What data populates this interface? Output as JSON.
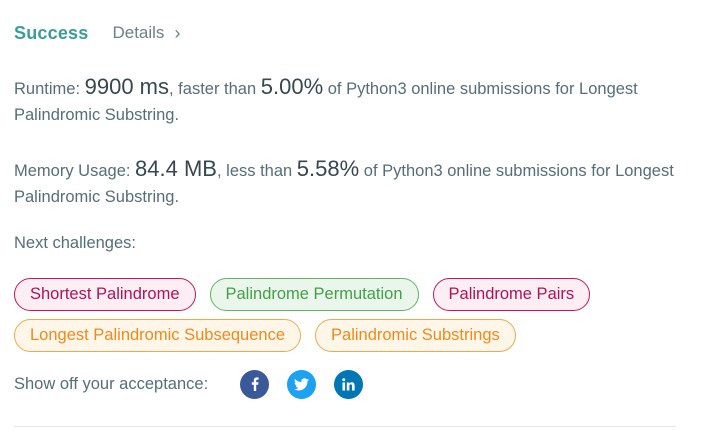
{
  "header": {
    "status": "Success",
    "details_label": "Details",
    "chevron": "›"
  },
  "runtime": {
    "label": "Runtime:",
    "value": "9900 ms",
    "comparison_text": ", faster than",
    "percent": "5.00%",
    "suffix": "of Python3 online submissions for Longest Palindromic Substring."
  },
  "memory": {
    "label": "Memory Usage:",
    "value": "84.4 MB",
    "comparison_text": ", less than",
    "percent": "5.58%",
    "suffix": "of Python3 online submissions for Longest Palindromic Substring."
  },
  "next": {
    "label": "Next challenges:",
    "challenges": [
      {
        "title": "Shortest Palindrome",
        "difficulty": "hard"
      },
      {
        "title": "Palindrome Permutation",
        "difficulty": "easy"
      },
      {
        "title": "Palindrome Pairs",
        "difficulty": "hard"
      },
      {
        "title": "Longest Palindromic Subsequence",
        "difficulty": "medium"
      },
      {
        "title": "Palindromic Substrings",
        "difficulty": "medium"
      }
    ]
  },
  "share": {
    "label": "Show off your acceptance:",
    "icons": [
      {
        "name": "facebook-icon",
        "color": "#3b5998"
      },
      {
        "name": "twitter-icon",
        "color": "#1da1f2"
      },
      {
        "name": "linkedin-icon",
        "color": "#0077b5"
      }
    ]
  },
  "colors": {
    "success": "#3a9e97",
    "hard": "#c2185b",
    "easy": "#5cb85c",
    "medium": "#f0a947"
  }
}
